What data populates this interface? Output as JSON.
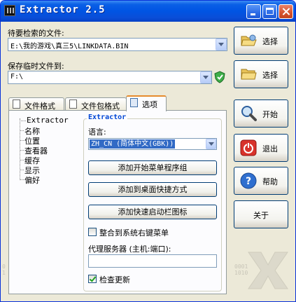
{
  "window": {
    "title": "Extractor 2.5"
  },
  "fields": {
    "search_file_label": "待要检索的文件:",
    "search_file_value": "E:\\我的游戏\\真三5\\LINKDATA.BIN",
    "temp_dir_label": "保存临时文件到:",
    "temp_dir_value": "F:\\"
  },
  "side_buttons": {
    "select1": "选择",
    "select2": "选择",
    "start": "开始",
    "exit": "退出",
    "help": "帮助",
    "about": "关于"
  },
  "tabs": [
    "文件格式",
    "文件包格式",
    "选项"
  ],
  "tree": {
    "root": "Extractor",
    "items": [
      "名称",
      "位置",
      "查看器",
      "缓存",
      "显示",
      "偏好"
    ]
  },
  "options": {
    "group_title": "Extractor",
    "language_label": "语言:",
    "language_value": "ZH_CN (简体中文(GBK))",
    "add_start_menu": "添加开始菜单程序组",
    "add_desktop": "添加到桌面快捷方式",
    "add_quicklaunch": "添加快速启动栏图标",
    "context_menu_label": "整合到系统右键菜单",
    "context_menu_checked": false,
    "proxy_label": "代理服务器 (主机:端口):",
    "proxy_value": "",
    "check_update_label": "检查更新",
    "check_update_checked": true
  },
  "colors": {
    "accent": "#0054e3",
    "group_title": "#0046d5",
    "selection": "#316ac5"
  }
}
